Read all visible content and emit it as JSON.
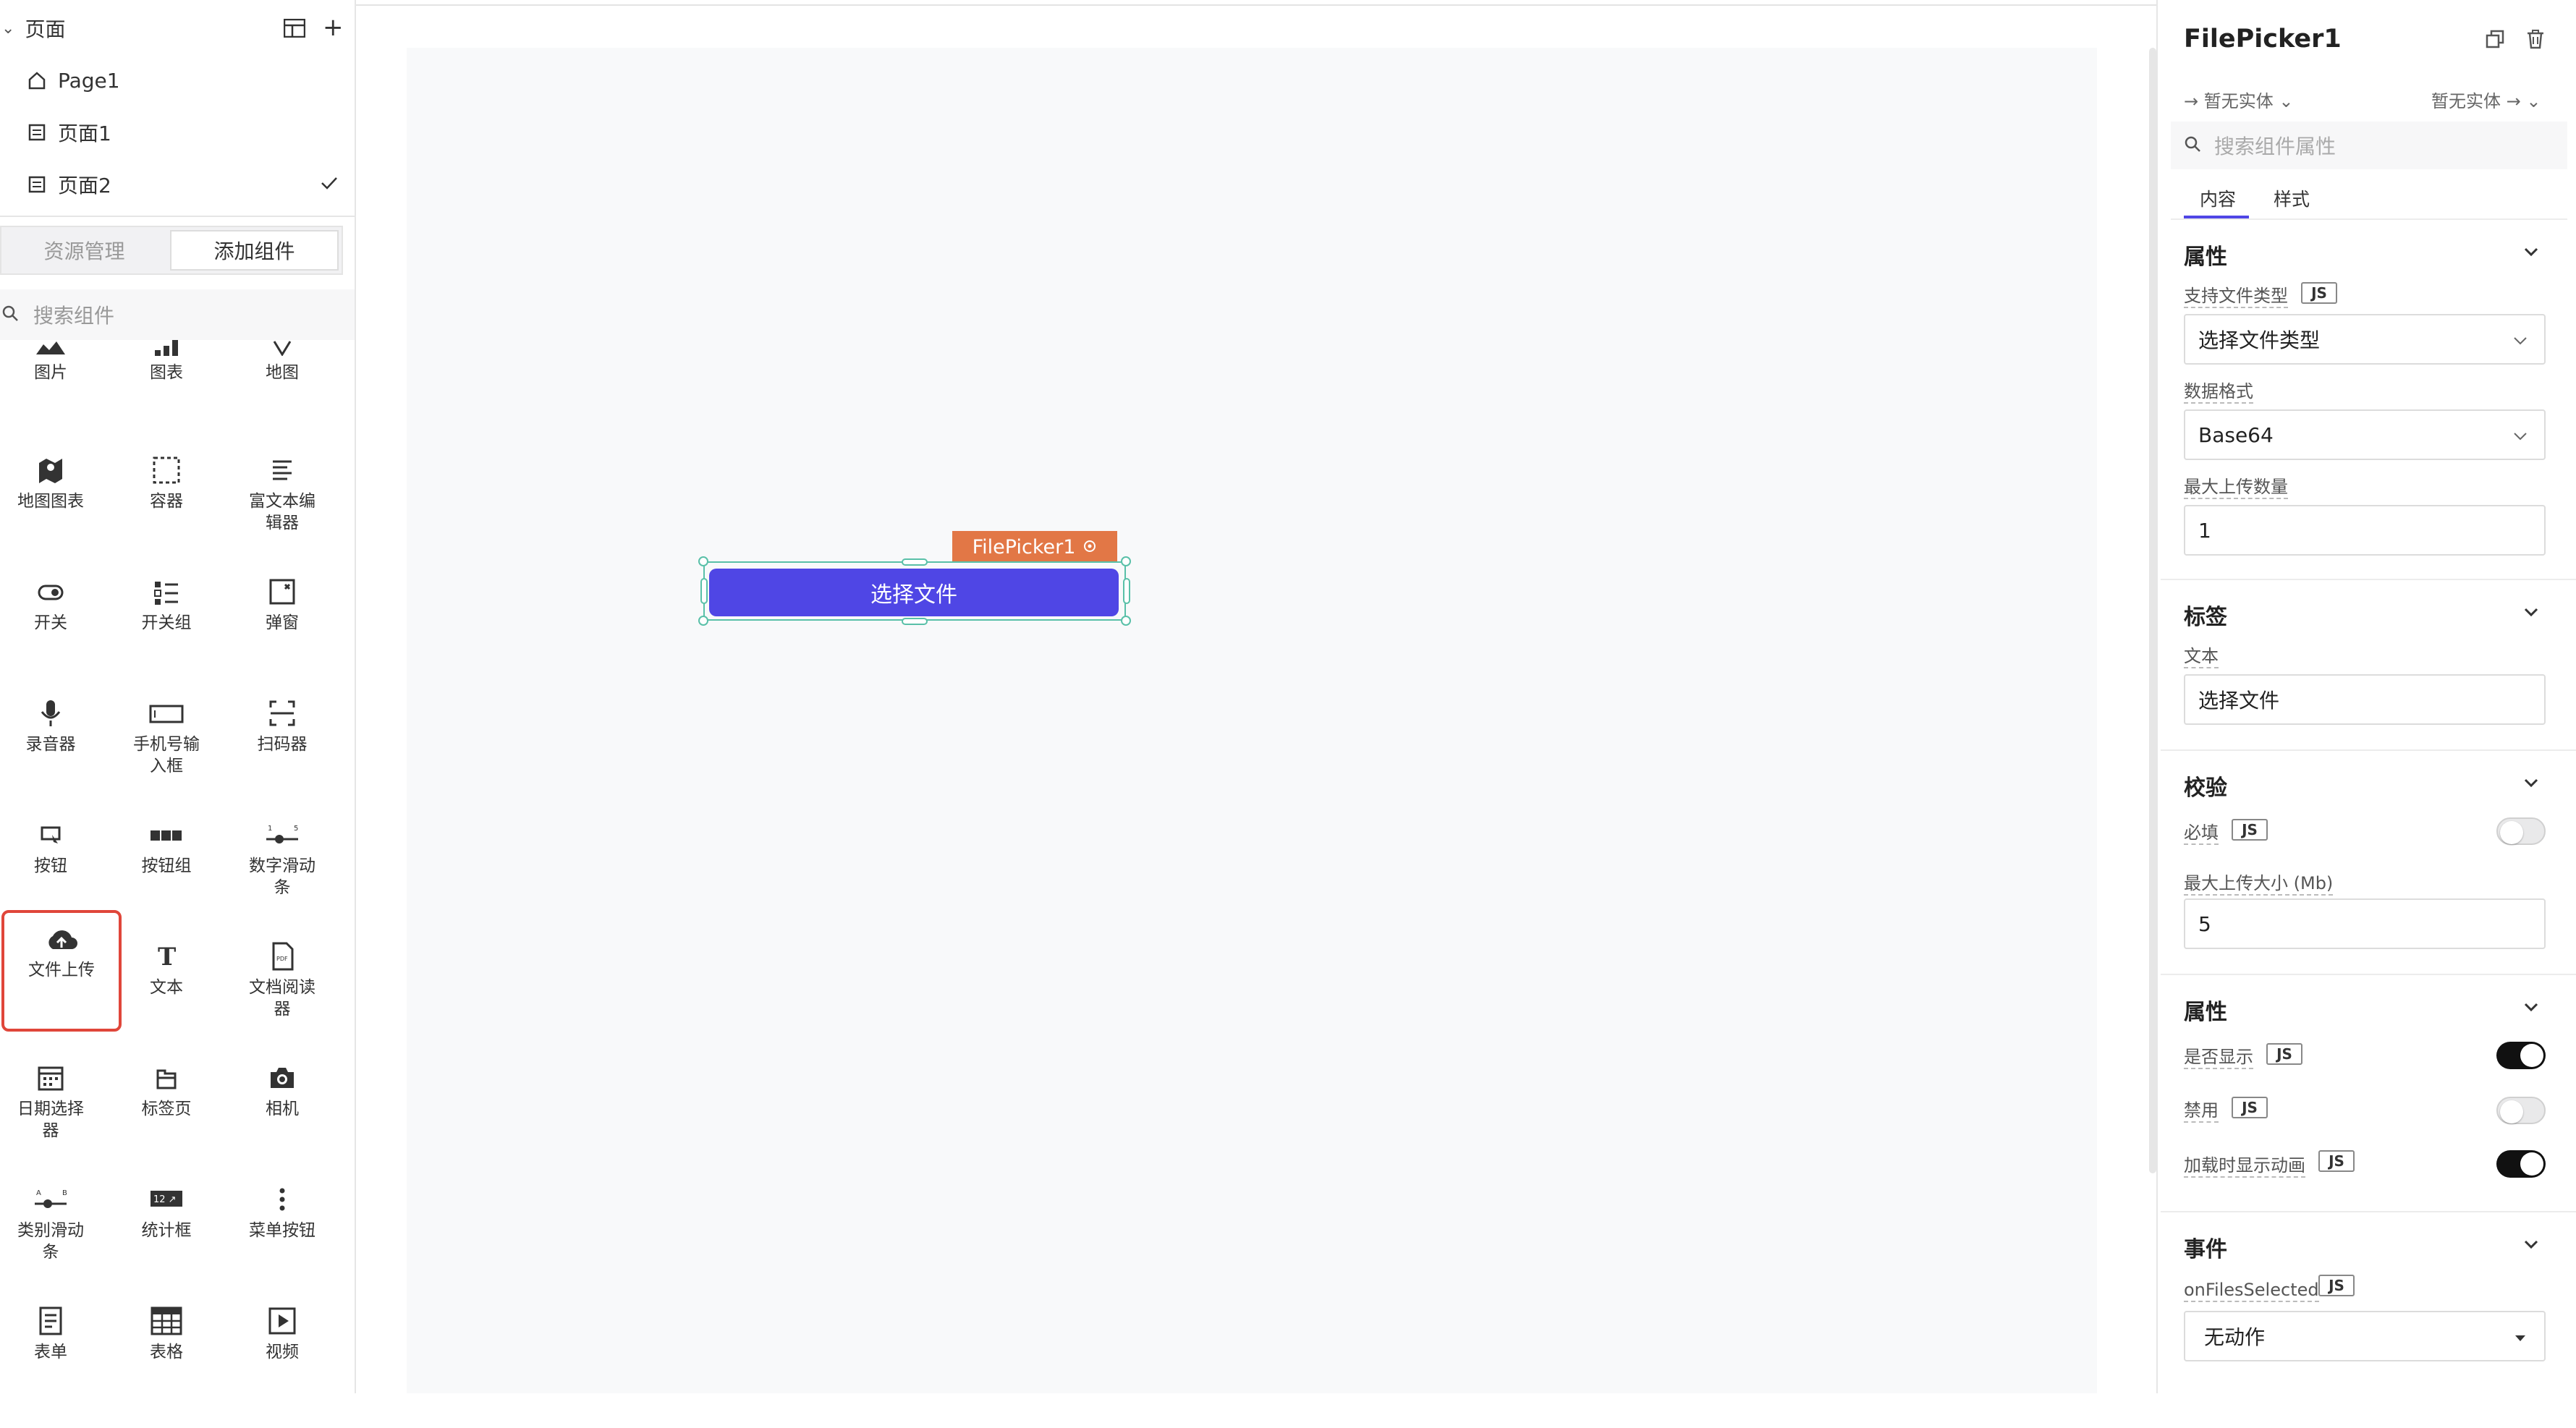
{
  "left": {
    "pages_header": "页面",
    "pages": [
      {
        "label": "Page1",
        "icon": "home-icon"
      },
      {
        "label": "页面1",
        "icon": "page-icon"
      },
      {
        "label": "页面2",
        "icon": "page-icon",
        "checked": true
      }
    ],
    "tabs": [
      "资源管理",
      "添加组件"
    ],
    "active_tab": "添加组件",
    "search_placeholder": "搜索组件",
    "components": [
      [
        "图片",
        "图表",
        "地图"
      ],
      [
        "地图图表",
        "容器",
        "富文本编",
        "辑器"
      ],
      [
        "开关",
        "开关组",
        "弹窗"
      ],
      [
        "录音器",
        "手机号输",
        "入框",
        "扫码器"
      ],
      [
        "按钮",
        "按钮组",
        "数字滑动",
        "条"
      ],
      [
        "文件上传",
        "文本",
        "文档阅读",
        "器"
      ],
      [
        "日期选择",
        "器",
        "标签页",
        "相机"
      ],
      [
        "类别滑动",
        "条",
        "统计框",
        "菜单按钮"
      ],
      [
        "表单",
        "表格",
        "视频"
      ]
    ]
  },
  "canvas": {
    "component_tag": "FilePicker1",
    "button_label": "选择文件"
  },
  "right": {
    "title": "FilePicker1",
    "entity_left": "暂无实体",
    "entity_right": "暂无实体",
    "search_placeholder": "搜索组件属性",
    "tabs": [
      "内容",
      "样式"
    ],
    "sections": {
      "props": {
        "title": "属性",
        "file_types_label": "支持文件类型",
        "file_types_value": "选择文件类型",
        "data_format_label": "数据格式",
        "data_format_value": "Base64",
        "max_count_label": "最大上传数量",
        "max_count_value": "1"
      },
      "label": {
        "title": "标签",
        "text_label": "文本",
        "text_value": "选择文件"
      },
      "validation": {
        "title": "校验",
        "required_label": "必填",
        "max_size_label": "最大上传大小 (Mb)",
        "max_size_value": "5"
      },
      "attrs": {
        "title": "属性",
        "visible_label": "是否显示",
        "disabled_label": "禁用",
        "loading_label": "加载时显示动画"
      },
      "events": {
        "title": "事件",
        "event_label": "onFilesSelected",
        "event_value": "无动作"
      }
    },
    "js": "JS"
  }
}
